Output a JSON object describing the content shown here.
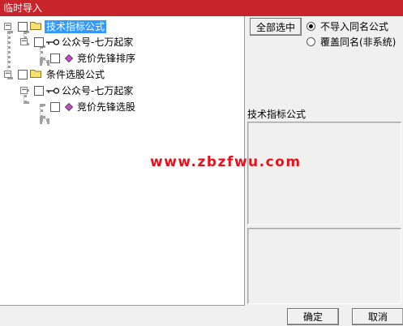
{
  "window": {
    "title": "临时导入"
  },
  "tree": {
    "nodes": [
      {
        "label": "技术指标公式",
        "selected": true
      },
      {
        "label": "公众号-七万起家"
      },
      {
        "label": "竞价先锋排序"
      },
      {
        "label": "条件选股公式"
      },
      {
        "label": "公众号-七万起家"
      },
      {
        "label": "竞价先锋选股"
      }
    ],
    "expander_symbol": "−"
  },
  "options": {
    "select_all_label": "全部选中",
    "radio_skip_label": "不导入同名公式",
    "radio_overwrite_label": "覆盖同名(非系统)",
    "selected_radio": "skip"
  },
  "info": {
    "selected_type": "技术指标公式"
  },
  "watermark": "www.zbzfwu.com",
  "footer": {
    "ok_label": "确定",
    "cancel_label": "取消"
  },
  "colors": {
    "titlebar": "#c7242b",
    "selection": "#3399ff",
    "watermark": "#e8101a",
    "folder": "#f5e16b",
    "diamond": "#c050c0"
  },
  "icons": [
    "folder-icon",
    "key-icon",
    "formula-diamond-icon"
  ]
}
